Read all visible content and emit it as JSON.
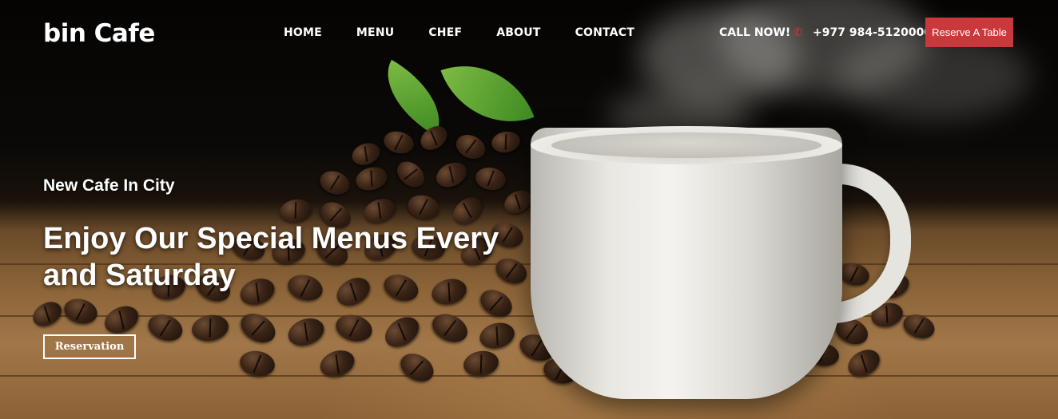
{
  "brand": {
    "name": "bin Cafe"
  },
  "nav": {
    "items": [
      {
        "label": "HOME"
      },
      {
        "label": "MENU"
      },
      {
        "label": "CHEF"
      },
      {
        "label": "ABOUT"
      },
      {
        "label": "CONTACT"
      }
    ],
    "call_label": "CALL NOW!",
    "phone_icon": "phone-icon",
    "phone_number": "+977 984-5120000",
    "reserve_button": "Reserve A Table"
  },
  "hero": {
    "subtitle": "New Cafe In City",
    "headline_line1": "Enjoy Our Special Menus Every",
    "headline_line2": "and Saturday",
    "cta_label": "Reservation",
    "background_image": "coffee cup with coffee beans and mint leaf on wooden table"
  },
  "colors": {
    "accent": "#c9383a",
    "text": "#ffffff",
    "phone_icon": "#e0342b"
  }
}
